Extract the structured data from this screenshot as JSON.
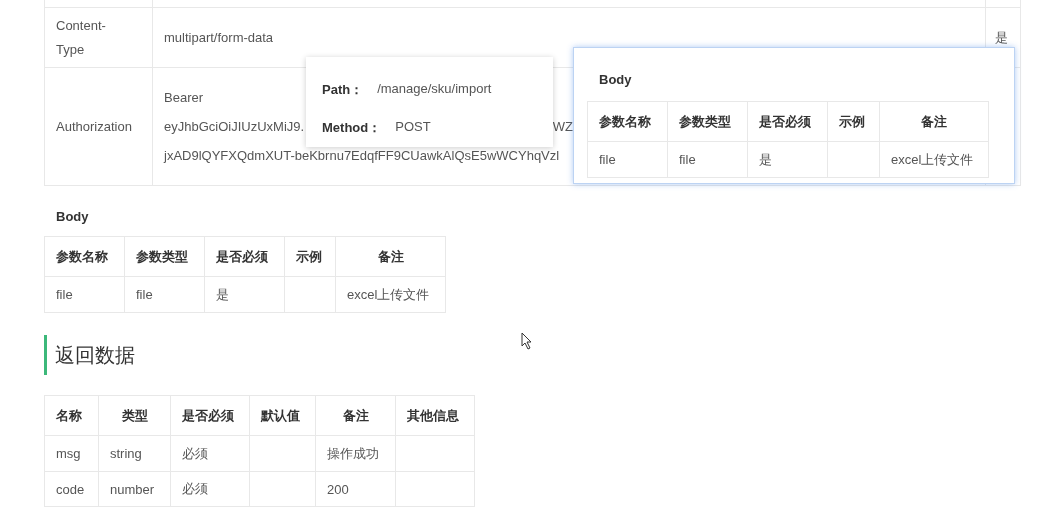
{
  "headers_table": {
    "rows": [
      {
        "name": "Content-\nType",
        "value_lines": [
          "multipart/form-data"
        ],
        "required": "是"
      },
      {
        "name": "Authorization",
        "value_lines": [
          "Bearer",
          [
            "eyJhbGciOiJIUzUxMiJ9.",
            "WZ"
          ],
          "jxAD9lQYFXQdmXUT-beKbrnu7EdqfFF9CUawkAlQsE5wWCYhqVzl"
        ]
      }
    ]
  },
  "body": {
    "title": "Body",
    "columns": [
      "参数名称",
      "参数类型",
      "是否必须",
      "示例",
      "备注"
    ],
    "rows": [
      [
        "file",
        "file",
        "是",
        "",
        "excel上传文件"
      ]
    ]
  },
  "returns": {
    "title": "返回数据",
    "columns": [
      "名称",
      "类型",
      "是否必须",
      "默认值",
      "备注",
      "其他信息"
    ],
    "rows": [
      [
        "msg",
        "string",
        "必须",
        "",
        "操作成功",
        ""
      ],
      [
        "code",
        "number",
        "必须",
        "",
        "200",
        ""
      ]
    ]
  },
  "path_popup": {
    "fields": [
      {
        "label": "Path：",
        "value": "/manage/sku/import"
      },
      {
        "label": "Method：",
        "value": "POST"
      }
    ]
  },
  "body_popup": {
    "title": "Body",
    "columns": [
      "参数名称",
      "参数类型",
      "是否必须",
      "示例",
      "备注"
    ],
    "rows": [
      [
        "file",
        "file",
        "是",
        "",
        "excel上传文件"
      ]
    ]
  }
}
